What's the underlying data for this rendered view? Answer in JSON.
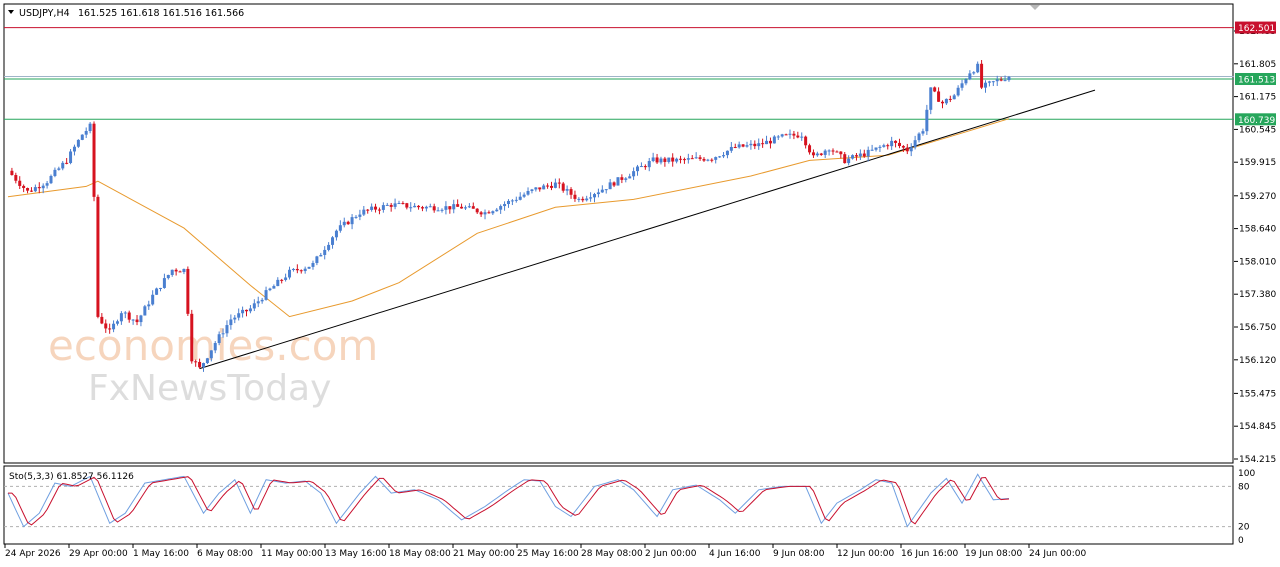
{
  "header": {
    "symbol": "USDJPY,H4",
    "ohlc": "161.525 161.618 161.516 161.566"
  },
  "watermark": {
    "brand1": "economies.com",
    "brand2": "FxNewsToday"
  },
  "price_axis": {
    "ticks": [
      "162.435",
      "161.805",
      "161.175",
      "160.545",
      "159.915",
      "159.270",
      "158.640",
      "158.010",
      "157.380",
      "156.750",
      "156.120",
      "155.475",
      "154.845",
      "154.215"
    ]
  },
  "markers": [
    {
      "label": "162.501",
      "value": 162.501,
      "color": "#c8102e"
    },
    {
      "label": "161.513",
      "value": 161.513,
      "color": "#26a65b"
    },
    {
      "label": "160.739",
      "value": 160.739,
      "color": "#26a65b"
    }
  ],
  "time_axis": {
    "labels": [
      "24 Apr 2026",
      "29 Apr 00:00",
      "1 May 16:00",
      "6 May 08:00",
      "11 May 00:00",
      "13 May 16:00",
      "18 May 08:00",
      "21 May 00:00",
      "25 May 16:00",
      "28 May 08:00",
      "2 Jun 00:00",
      "4 Jun 16:00",
      "9 Jun 08:00",
      "12 Jun 00:00",
      "16 Jun 16:00",
      "19 Jun 08:00",
      "24 Jun 00:00"
    ]
  },
  "oscillator": {
    "label": "Sto(5,3,3) 61.8527 56.1126",
    "ticks": [
      "100",
      "80",
      "20",
      "0"
    ],
    "k_last": 61.8527,
    "d_last": 56.1126
  },
  "colors": {
    "bull": "#4a7fd0",
    "bear": "#d6121f",
    "ma": "#e89a2e",
    "trend": "#000000",
    "stoch_k": "#6f9fe0",
    "stoch_d": "#c8102e"
  },
  "chart_data": {
    "type": "candlestick",
    "title": "USDJPY,H4",
    "ylim": [
      154.215,
      162.435
    ],
    "keypoints": [
      {
        "t": 0,
        "p": 159.75
      },
      {
        "t": 5,
        "p": 159.35
      },
      {
        "t": 10,
        "p": 159.55
      },
      {
        "t": 15,
        "p": 159.95
      },
      {
        "t": 19,
        "p": 160.45
      },
      {
        "t": 21,
        "p": 160.6
      },
      {
        "t": 22,
        "p": 159.25
      },
      {
        "t": 23,
        "p": 156.95
      },
      {
        "t": 26,
        "p": 156.65
      },
      {
        "t": 29,
        "p": 157.05
      },
      {
        "t": 33,
        "p": 156.85
      },
      {
        "t": 37,
        "p": 157.35
      },
      {
        "t": 42,
        "p": 157.85
      },
      {
        "t": 45,
        "p": 157.85
      },
      {
        "t": 46,
        "p": 157.05
      },
      {
        "t": 47,
        "p": 156.15
      },
      {
        "t": 49,
        "p": 155.95
      },
      {
        "t": 53,
        "p": 156.45
      },
      {
        "t": 57,
        "p": 156.9
      },
      {
        "t": 62,
        "p": 157.1
      },
      {
        "t": 66,
        "p": 157.4
      },
      {
        "t": 72,
        "p": 157.8
      },
      {
        "t": 78,
        "p": 157.95
      },
      {
        "t": 84,
        "p": 158.6
      },
      {
        "t": 90,
        "p": 158.95
      },
      {
        "t": 98,
        "p": 159.1
      },
      {
        "t": 106,
        "p": 159.05
      },
      {
        "t": 116,
        "p": 159.05
      },
      {
        "t": 122,
        "p": 158.95
      },
      {
        "t": 128,
        "p": 159.15
      },
      {
        "t": 135,
        "p": 159.4
      },
      {
        "t": 140,
        "p": 159.5
      },
      {
        "t": 146,
        "p": 159.2
      },
      {
        "t": 152,
        "p": 159.4
      },
      {
        "t": 158,
        "p": 159.65
      },
      {
        "t": 165,
        "p": 159.95
      },
      {
        "t": 172,
        "p": 159.95
      },
      {
        "t": 180,
        "p": 160.0
      },
      {
        "t": 186,
        "p": 160.2
      },
      {
        "t": 192,
        "p": 160.25
      },
      {
        "t": 198,
        "p": 160.4
      },
      {
        "t": 203,
        "p": 160.45
      },
      {
        "t": 206,
        "p": 160.0
      },
      {
        "t": 210,
        "p": 160.2
      },
      {
        "t": 214,
        "p": 159.95
      },
      {
        "t": 220,
        "p": 160.1
      },
      {
        "t": 226,
        "p": 160.3
      },
      {
        "t": 230,
        "p": 160.15
      },
      {
        "t": 234,
        "p": 160.55
      },
      {
        "t": 236,
        "p": 161.3
      },
      {
        "t": 239,
        "p": 161.05
      },
      {
        "t": 242,
        "p": 161.2
      },
      {
        "t": 246,
        "p": 161.65
      },
      {
        "t": 248,
        "p": 161.75
      },
      {
        "t": 249,
        "p": 161.35
      },
      {
        "t": 252,
        "p": 161.45
      },
      {
        "t": 256,
        "p": 161.57
      }
    ],
    "ma_keypoints": [
      {
        "t": 0,
        "p": 159.25
      },
      {
        "t": 20,
        "p": 159.45
      },
      {
        "t": 23,
        "p": 159.55
      },
      {
        "t": 45,
        "p": 158.65
      },
      {
        "t": 62,
        "p": 157.55
      },
      {
        "t": 72,
        "p": 156.95
      },
      {
        "t": 88,
        "p": 157.25
      },
      {
        "t": 100,
        "p": 157.6
      },
      {
        "t": 120,
        "p": 158.55
      },
      {
        "t": 140,
        "p": 159.05
      },
      {
        "t": 160,
        "p": 159.2
      },
      {
        "t": 190,
        "p": 159.65
      },
      {
        "t": 205,
        "p": 159.95
      },
      {
        "t": 225,
        "p": 160.05
      },
      {
        "t": 245,
        "p": 160.5
      },
      {
        "t": 256,
        "p": 160.75
      }
    ],
    "trendline": [
      {
        "t": 49,
        "p": 155.95
      },
      {
        "t": 278,
        "p": 161.3
      }
    ],
    "stoch_keypoints": [
      {
        "t": 0,
        "v": 70
      },
      {
        "t": 4,
        "v": 20
      },
      {
        "t": 8,
        "v": 40
      },
      {
        "t": 12,
        "v": 85
      },
      {
        "t": 16,
        "v": 80
      },
      {
        "t": 21,
        "v": 95
      },
      {
        "t": 26,
        "v": 25
      },
      {
        "t": 30,
        "v": 40
      },
      {
        "t": 35,
        "v": 85
      },
      {
        "t": 40,
        "v": 90
      },
      {
        "t": 45,
        "v": 95
      },
      {
        "t": 50,
        "v": 40
      },
      {
        "t": 54,
        "v": 70
      },
      {
        "t": 58,
        "v": 90
      },
      {
        "t": 62,
        "v": 40
      },
      {
        "t": 66,
        "v": 90
      },
      {
        "t": 71,
        "v": 85
      },
      {
        "t": 76,
        "v": 88
      },
      {
        "t": 80,
        "v": 70
      },
      {
        "t": 84,
        "v": 25
      },
      {
        "t": 90,
        "v": 70
      },
      {
        "t": 94,
        "v": 95
      },
      {
        "t": 98,
        "v": 70
      },
      {
        "t": 104,
        "v": 75
      },
      {
        "t": 110,
        "v": 60
      },
      {
        "t": 116,
        "v": 30
      },
      {
        "t": 122,
        "v": 50
      },
      {
        "t": 128,
        "v": 75
      },
      {
        "t": 132,
        "v": 90
      },
      {
        "t": 136,
        "v": 88
      },
      {
        "t": 140,
        "v": 50
      },
      {
        "t": 144,
        "v": 35
      },
      {
        "t": 150,
        "v": 80
      },
      {
        "t": 156,
        "v": 90
      },
      {
        "t": 160,
        "v": 75
      },
      {
        "t": 166,
        "v": 35
      },
      {
        "t": 170,
        "v": 75
      },
      {
        "t": 176,
        "v": 82
      },
      {
        "t": 182,
        "v": 60
      },
      {
        "t": 186,
        "v": 40
      },
      {
        "t": 192,
        "v": 75
      },
      {
        "t": 198,
        "v": 80
      },
      {
        "t": 204,
        "v": 80
      },
      {
        "t": 208,
        "v": 25
      },
      {
        "t": 212,
        "v": 55
      },
      {
        "t": 218,
        "v": 75
      },
      {
        "t": 222,
        "v": 90
      },
      {
        "t": 226,
        "v": 85
      },
      {
        "t": 230,
        "v": 20
      },
      {
        "t": 236,
        "v": 70
      },
      {
        "t": 240,
        "v": 92
      },
      {
        "t": 244,
        "v": 55
      },
      {
        "t": 248,
        "v": 98
      },
      {
        "t": 252,
        "v": 60
      },
      {
        "t": 256,
        "v": 62
      }
    ]
  }
}
